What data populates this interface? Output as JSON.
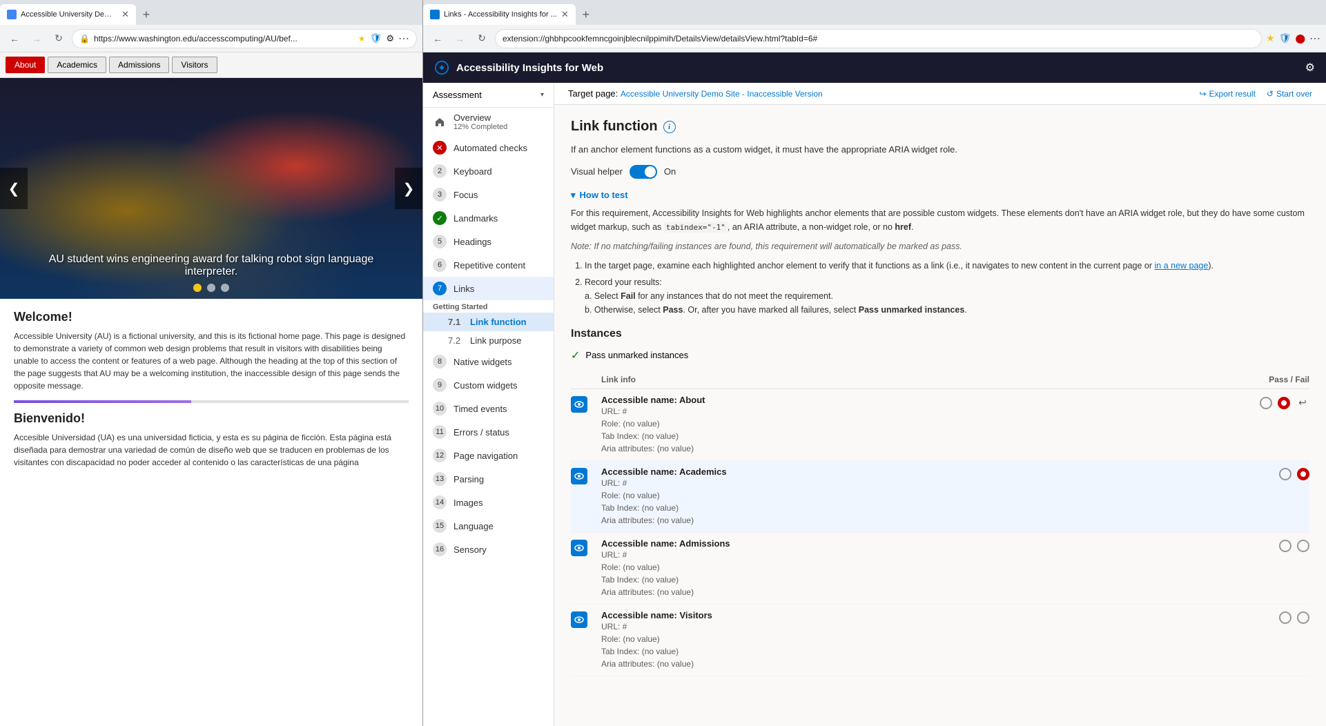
{
  "left_window": {
    "tab_title": "Accessible University Demo Site",
    "url": "https://www.washington.edu/accesscomputing/AU/bef...",
    "nav_items": [
      {
        "label": "About",
        "active": true
      },
      {
        "label": "Academics",
        "active": false
      },
      {
        "label": "Admissions",
        "active": false
      },
      {
        "label": "Visitors",
        "active": false
      }
    ],
    "carousel": {
      "caption": "AU student wins engineering award for talking robot sign language interpreter.",
      "dots": [
        "active",
        "inactive",
        "inactive"
      ]
    },
    "welcome_heading": "Welcome!",
    "welcome_text": "Accessible University (AU) is a fictional university, and this is its fictional home page. This page is designed to demonstrate a variety of common web design problems that result in visitors with disabilities being unable to access the content or features of a web page. Although the heading at the top of this section of the page suggests that AU may be a welcoming institution, the inaccessible design of this page sends the opposite message.",
    "bienvenido_heading": "Bienvenido!",
    "bienvenido_text": "Accesible Universidad (UA) es una universidad ficticia, y esta es su página de ficción. Esta página está diseñada para demostrar una variedad de común de diseño web que se traducen en problemas de los visitantes con discapacidad no poder acceder al contenido o las características de una página"
  },
  "right_window": {
    "tab_title": "Links - Accessibility Insights for ...",
    "url": "extension://ghbhpcookfemncgoinjblecnilppimih/DetailsView/detailsView.html?tabId=6#",
    "header_title": "Accessibility Insights for Web",
    "gear_icon": "⚙",
    "target_page_label": "Target page:",
    "target_page_link": "Accessible University Demo Site - Inaccessible Version",
    "export_result": "Export result",
    "start_over": "Start over",
    "sidebar": {
      "assessment_label": "Assessment",
      "items": [
        {
          "num": "🏠",
          "type": "icon",
          "label": "Overview",
          "sublabel": "12% Completed",
          "active": false
        },
        {
          "num": "✕",
          "type": "error",
          "label": "Automated checks",
          "active": false
        },
        {
          "num": "2",
          "label": "Keyboard",
          "active": false
        },
        {
          "num": "3",
          "label": "Focus",
          "active": false
        },
        {
          "num": "✓",
          "type": "complete",
          "label": "Landmarks",
          "active": false
        },
        {
          "num": "5",
          "label": "Headings",
          "active": false
        },
        {
          "num": "6",
          "label": "Repetitive content",
          "active": false
        },
        {
          "num": "7",
          "label": "Links",
          "active": true
        },
        {
          "num": "8",
          "label": "Native widgets",
          "active": false
        },
        {
          "num": "9",
          "label": "Custom widgets",
          "active": false
        },
        {
          "num": "10",
          "label": "Timed events",
          "active": false
        },
        {
          "num": "11",
          "label": "Errors / status",
          "active": false
        },
        {
          "num": "12",
          "label": "Page navigation",
          "active": false
        },
        {
          "num": "13",
          "label": "Parsing",
          "active": false
        },
        {
          "num": "14",
          "label": "Images",
          "active": false
        },
        {
          "num": "15",
          "label": "Language",
          "active": false
        },
        {
          "num": "16",
          "label": "Sensory",
          "active": false
        }
      ],
      "getting_started": "Getting Started",
      "sub_items": [
        {
          "num": "7.1",
          "label": "Link function",
          "active": true
        },
        {
          "num": "7.2",
          "label": "Link purpose",
          "active": false
        }
      ]
    },
    "main": {
      "section_title": "Link function",
      "description": "If an anchor element functions as a custom widget, it must have the appropriate ARIA widget role.",
      "visual_helper_label": "Visual helper",
      "visual_helper_state": "On",
      "how_to_test_heading": "How to test",
      "how_to_body_p1": "For this requirement, Accessibility Insights for Web highlights anchor elements that are possible custom widgets. These elements don't have an ARIA widget role, but they do have some custom widget markup, such as tabindex=\"-1\", an ARIA attribute, a non-widget role, or no href.",
      "how_to_note": "Note: If no matching/failing instances are found, this requirement will automatically be marked as pass.",
      "how_to_step1": "In the target page, examine each highlighted anchor element to verify that it functions as a link (i.e., it navigates to new content in the current page or in a new page).",
      "how_to_step2": "Record your results:",
      "how_to_step2a": "Select Fail for any instances that do not meet the requirement.",
      "how_to_step2b": "Otherwise, select Pass. Or, after you have marked all failures, select Pass unmarked instances.",
      "instances_title": "Instances",
      "pass_unmarked_label": "Pass unmarked instances",
      "columns": {
        "link_info": "Link info",
        "pass_fail": "Pass / Fail"
      },
      "instances": [
        {
          "name": "Accessible name: About",
          "url": "URL: #",
          "role": "Role: (no value)",
          "tab_index": "Tab Index: (no value)",
          "aria": "Aria attributes: (no value)",
          "pass_selected": false,
          "fail_selected": true,
          "has_undo": true,
          "highlighted": false
        },
        {
          "name": "Accessible name: Academics",
          "url": "URL: #",
          "role": "Role: (no value)",
          "tab_index": "Tab Index: (no value)",
          "aria": "Aria attributes: (no value)",
          "pass_selected": false,
          "fail_selected": true,
          "has_undo": false,
          "highlighted": true
        },
        {
          "name": "Accessible name: Admissions",
          "url": "URL: #",
          "role": "Role: (no value)",
          "tab_index": "Tab Index: (no value)",
          "aria": "Aria attributes: (no value)",
          "pass_selected": false,
          "fail_selected": false,
          "has_undo": false,
          "highlighted": false
        },
        {
          "name": "Accessible name: Visitors",
          "url": "URL: #",
          "role": "Role: (no value)",
          "tab_index": "Tab Index: (no value)",
          "aria": "Aria attributes: (no value)",
          "pass_selected": false,
          "fail_selected": false,
          "has_undo": false,
          "highlighted": false
        }
      ]
    }
  }
}
